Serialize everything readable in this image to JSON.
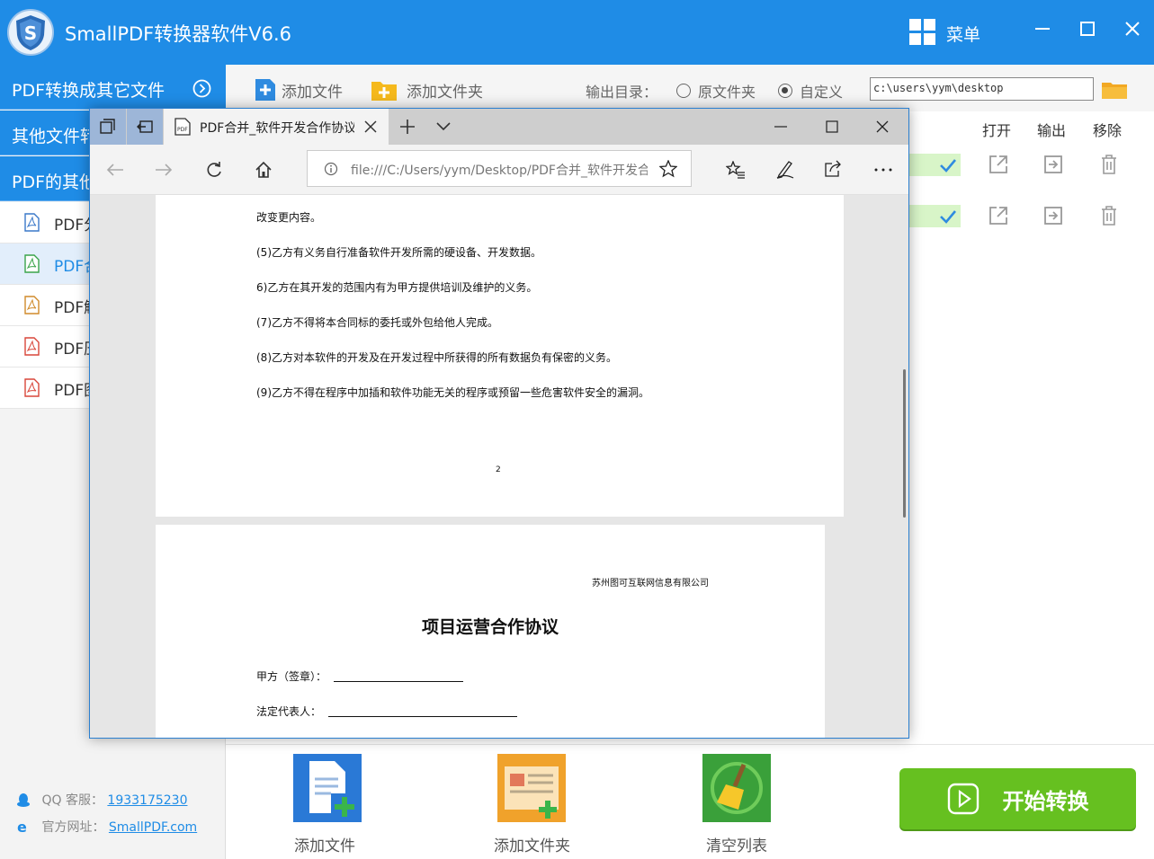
{
  "app": {
    "title": "SmallPDF转换器软件V6.6",
    "menu_label": "菜单",
    "accent": "#1f8ce6",
    "start_color": "#66c020"
  },
  "sidebar": {
    "categories": [
      {
        "label": "PDF转换成其它文件",
        "icon": "chevron-circle-right-icon"
      },
      {
        "label": "其他文件转换成PDF"
      },
      {
        "label": "PDF的其他操作"
      }
    ],
    "items": [
      {
        "label": "PDF分割",
        "icon": "pdf-file-icon"
      },
      {
        "label": "PDF合并",
        "icon": "pdf-file-icon",
        "active": true
      },
      {
        "label": "PDF解密",
        "icon": "pdf-file-icon"
      },
      {
        "label": "PDF压缩",
        "icon": "pdf-file-icon"
      },
      {
        "label": "PDF图片获取",
        "icon": "pdf-file-icon"
      }
    ],
    "contact": {
      "qq_label": "QQ 客服：",
      "qq_value": "1933175230",
      "site_label": "官方网址：",
      "site_value": "SmallPDF.com"
    }
  },
  "toolbar": {
    "add_file": "添加文件",
    "add_folder": "添加文件夹",
    "output_label": "输出目录：",
    "option_original": "原文件夹",
    "option_custom": "自定义",
    "selected_option": "自定义",
    "path_value": "c:\\users\\yym\\desktop"
  },
  "list": {
    "headers": {
      "open": "打开",
      "output": "输出",
      "remove": "移除"
    }
  },
  "bottom": {
    "add_file": "添加文件",
    "add_folder": "添加文件夹",
    "clear_list": "清空列表",
    "start": "开始转换"
  },
  "browser": {
    "tab_title": "PDF合并_软件开发合作协议",
    "address": "file:///C:/Users/yym/Desktop/PDF合并_软件开发合作协议.pdf",
    "page1_lines": [
      "改变更内容。",
      "(5)乙方有义务自行准备软件开发所需的硬设备、开发数据。",
      "6)乙方在其开发的范围内有为甲方提供培训及维护的义务。",
      "(7)乙方不得将本合同标的委托或外包给他人完成。",
      "(8)乙方对本软件的开发及在开发过程中所获得的所有数据负有保密的义务。",
      "(9)乙方不得在程序中加插和软件功能无关的程序或预留一些危害软件安全的漏洞。"
    ],
    "page_number": "2",
    "page2": {
      "company": "苏州图可互联网信息有限公司",
      "title": "项目运营合作协议",
      "party_a": "甲方（签章）：",
      "legal_rep": "法定代表人："
    }
  }
}
